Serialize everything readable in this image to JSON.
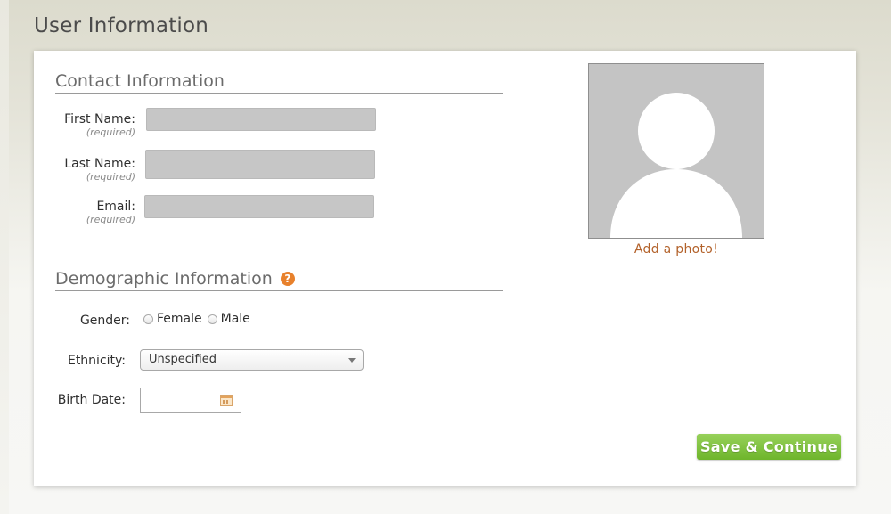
{
  "page": {
    "title": "User Information"
  },
  "contact": {
    "heading": "Contact Information",
    "required_note": "(required)",
    "first_name": {
      "label": "First Name:",
      "value": ""
    },
    "last_name": {
      "label": "Last Name:",
      "value": ""
    },
    "email": {
      "label": "Email:",
      "value": ""
    }
  },
  "photo": {
    "link_label": "Add a photo!"
  },
  "demographic": {
    "heading": "Demographic Information",
    "help_icon": "question-circle-icon",
    "gender": {
      "label": "Gender:",
      "options": [
        "Female",
        "Male"
      ]
    },
    "ethnicity": {
      "label": "Ethnicity:",
      "selected": "Unspecified"
    },
    "birth_date": {
      "label": "Birth Date:",
      "value": ""
    }
  },
  "actions": {
    "save_label": "Save & Continue"
  },
  "colors": {
    "accent_green": "#7cc23a",
    "photo_link": "#b3622b",
    "help_orange": "#e8812c",
    "input_fill": "#c6c6c6"
  }
}
